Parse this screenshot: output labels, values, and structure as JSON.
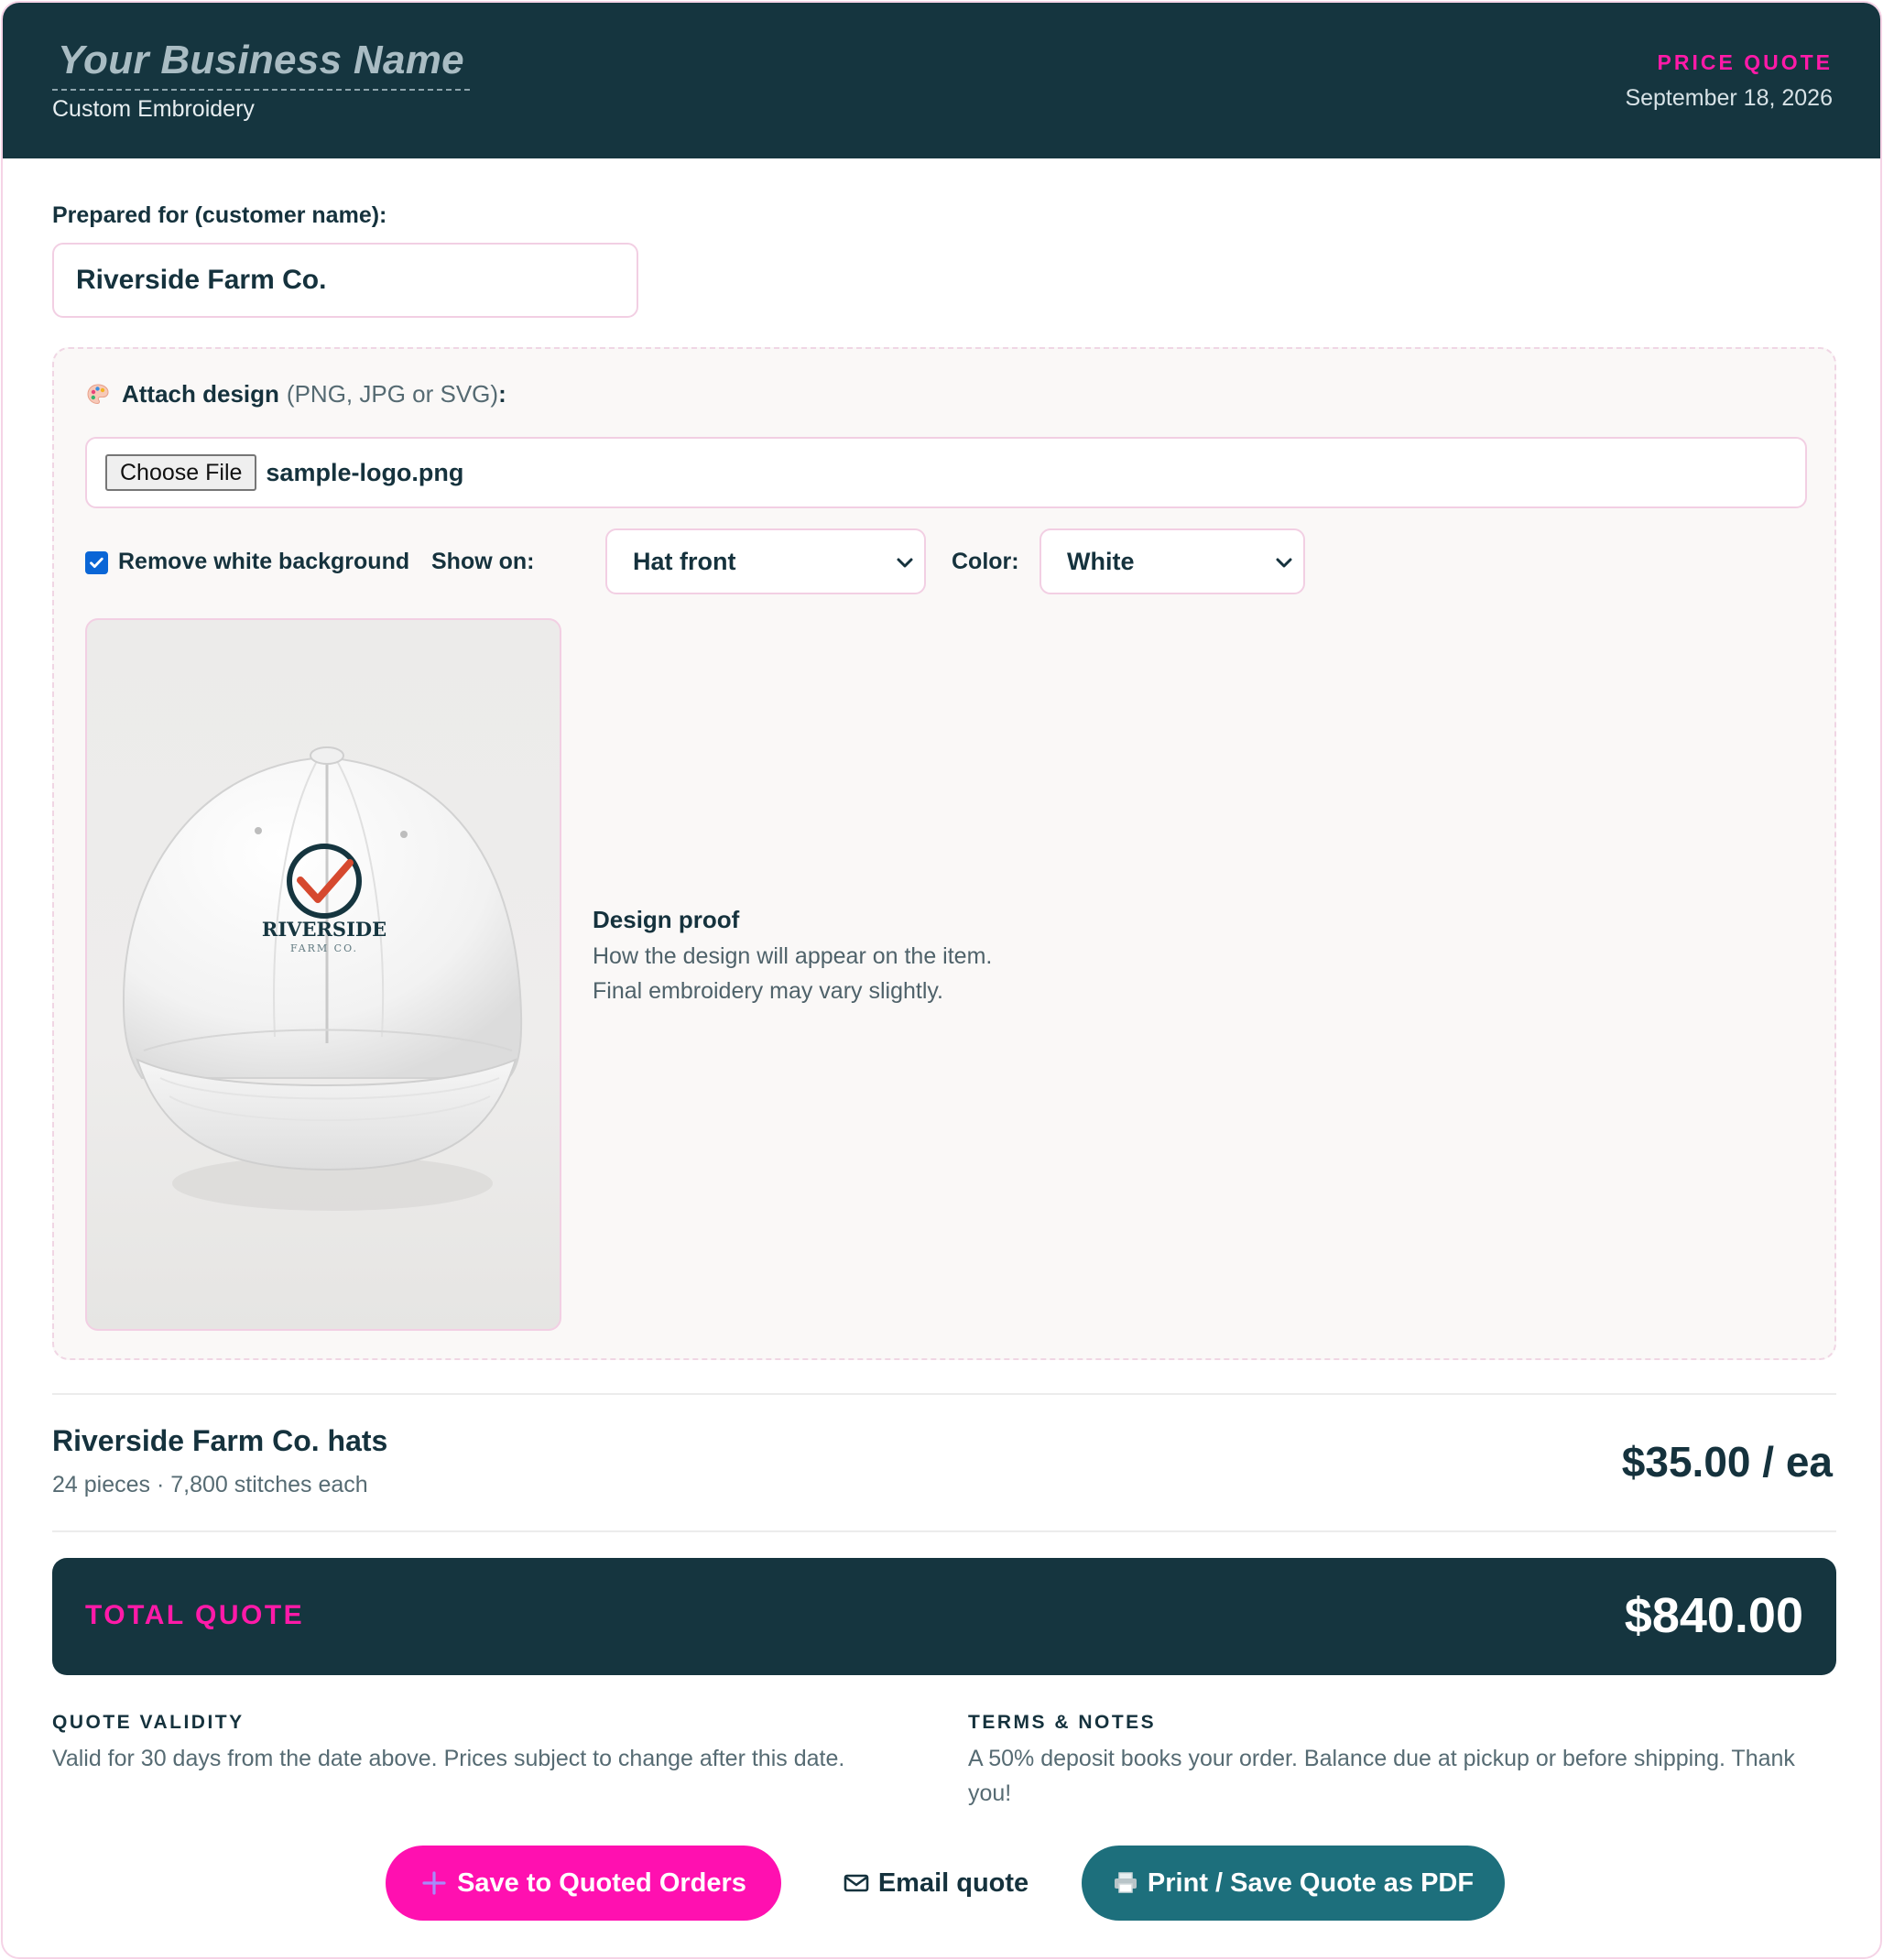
{
  "header": {
    "business_name": "Your Business Name",
    "business_subtitle": "Custom Embroidery",
    "doc_type": "PRICE QUOTE",
    "date": "September 18, 2026"
  },
  "customer": {
    "label": "Prepared for (customer name):",
    "value": "Riverside Farm Co."
  },
  "design": {
    "attach_label": "Attach design",
    "attach_hint": "(PNG, JPG or SVG)",
    "attach_colon": ":",
    "choose_button": "Choose File",
    "file_name": "sample-logo.png",
    "remove_bg_label": "Remove white background",
    "remove_bg_checked": true,
    "show_on_label": "Show on:",
    "show_on_value": "Hat front",
    "color_label": "Color:",
    "color_value": "White",
    "logo_text": "RIVERSIDE",
    "logo_subtext": "FARM CO.",
    "proof_title": "Design proof",
    "proof_description": "How the design will appear on the item. Final embroidery may vary slightly."
  },
  "line_item": {
    "name": "Riverside Farm Co. hats",
    "meta": "24 pieces · 7,800 stitches each",
    "price": "$35.00 / ea"
  },
  "total": {
    "label": "TOTAL QUOTE",
    "value": "$840.00"
  },
  "validity": {
    "heading": "QUOTE VALIDITY",
    "text": "Valid for 30 days from the date above. Prices subject to change after this date."
  },
  "terms": {
    "heading": "TERMS & NOTES",
    "text": "A 50% deposit books your order. Balance due at pickup or before shipping. Thank you!"
  },
  "actions": {
    "save": "Save to Quoted Orders",
    "email": "Email quote",
    "print": "Print / Save Quote as PDF"
  },
  "colors": {
    "brand_dark": "#15353f",
    "accent_pink": "#ff10b0",
    "teal": "#1d6f7c"
  },
  "icons": [
    "palette-icon",
    "chevron-down-icon",
    "plus-icon",
    "mail-icon",
    "printer-icon",
    "checkmark-icon"
  ]
}
